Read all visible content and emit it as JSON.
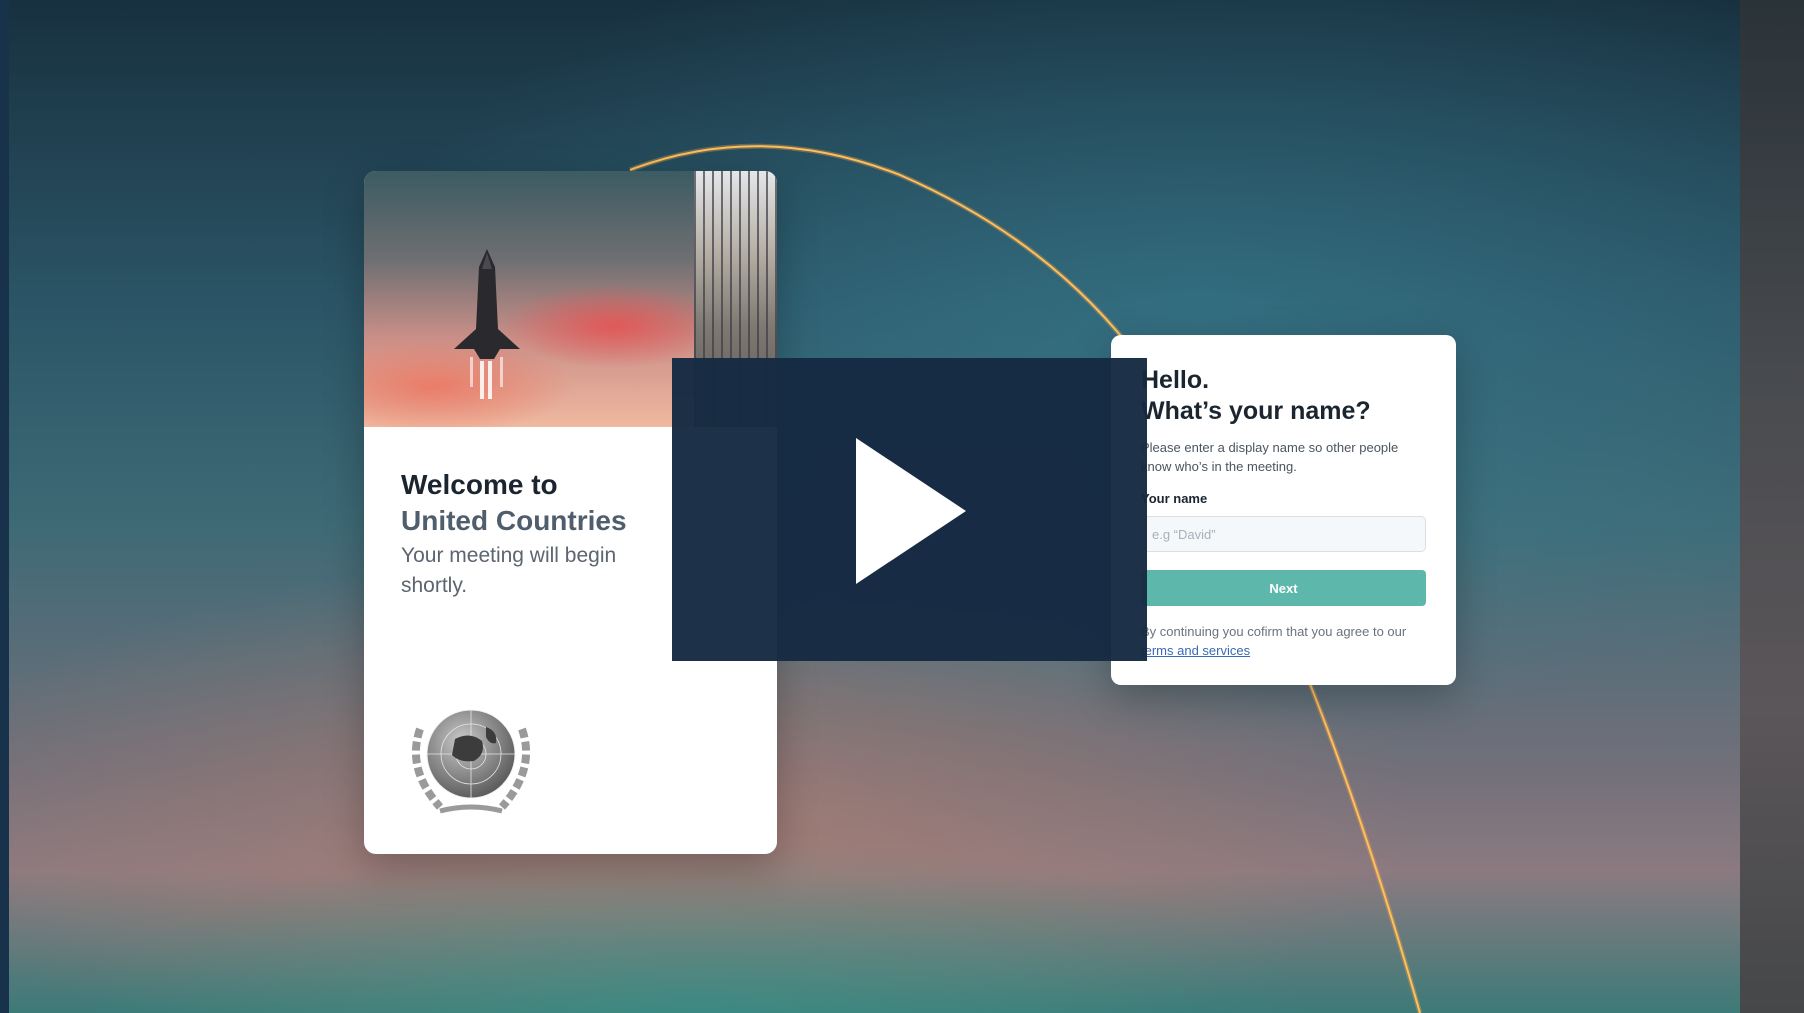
{
  "welcome_card": {
    "title_line1": "Welcome to",
    "title_line2": "United Countries",
    "subtitle": "Your meeting will begin shortly.",
    "hero_image": "rocket-launch-and-flags",
    "emblem": "laurel-globe-emblem"
  },
  "name_card": {
    "greeting_line1": "Hello.",
    "greeting_line2": "What’s your name?",
    "instructions": "Please enter a display name so other people know who’s in the meeting.",
    "field_label": "Your name",
    "placeholder": "e.g “David”",
    "next_label": "Next",
    "consent_prefix": "By continuing you cofirm that you agree to our",
    "terms_link": "terms and services"
  },
  "video": {
    "play_icon": "play-icon"
  },
  "colors": {
    "accent_teal": "#5db7aa",
    "overlay_navy": "#162a42",
    "title_dark": "#1b2530",
    "link_blue": "#3a6ab5"
  }
}
